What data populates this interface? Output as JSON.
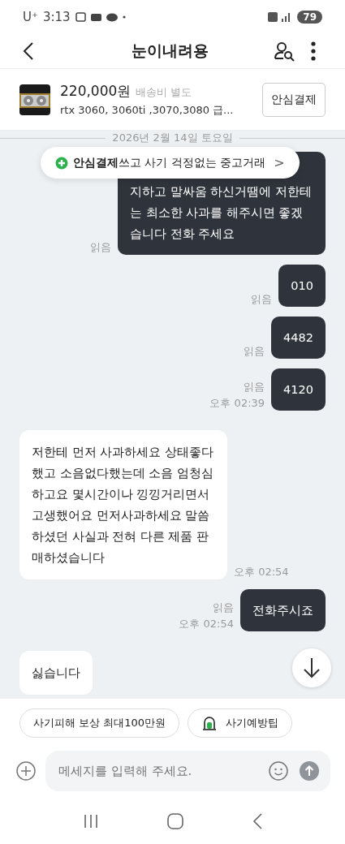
{
  "status_bar": {
    "carrier": "U⁺",
    "time": "3:13",
    "battery": "79"
  },
  "header": {
    "title": "눈이내려용"
  },
  "product": {
    "price": "220,000원",
    "shipping": "배송비 별도",
    "name": "rtx 3060, 3060ti ,3070,3080 급...",
    "button": "안심결제"
  },
  "date_separator": "2026년 2월 14일 토요일",
  "banner": {
    "bold": "안심결제",
    "text": "쓰고 사기 걱정없는 중고거래",
    "chevron": ">"
  },
  "messages": [
    {
      "kind": "sent",
      "text": "지하고 말싸움 하신거땜에 저한테는 최소한 사과를 해주시면 좋겠습니다 전화 주세요",
      "read": "읽음",
      "covered_top": true
    },
    {
      "kind": "sent",
      "text": "010",
      "read": "읽음"
    },
    {
      "kind": "sent",
      "text": "4482",
      "read": "읽음"
    },
    {
      "kind": "sent",
      "text": "4120",
      "read": "읽음",
      "time": "오후 02:39"
    },
    {
      "kind": "received",
      "text": "저한테 먼저 사과하세요 상태좋다 했고 소음없다했는데 소음 엄청심하고요 몇시간이나 낑낑거리면서 고생했어요 먼저사과하세요 말씀하셨던 사실과 전혀 다른 제품 판매하셨습니다",
      "time": "오후 02:54"
    },
    {
      "kind": "sent",
      "text": "전화주시죠",
      "read": "읽음",
      "time": "오후 02:54"
    },
    {
      "kind": "received",
      "text": "싫습니다"
    }
  ],
  "quick_chips": [
    {
      "label": "사기피해 보상 최대100만원"
    },
    {
      "label": "사기예방팁",
      "icon": true
    }
  ],
  "composer": {
    "placeholder": "메세지를 입력해 주세요."
  }
}
